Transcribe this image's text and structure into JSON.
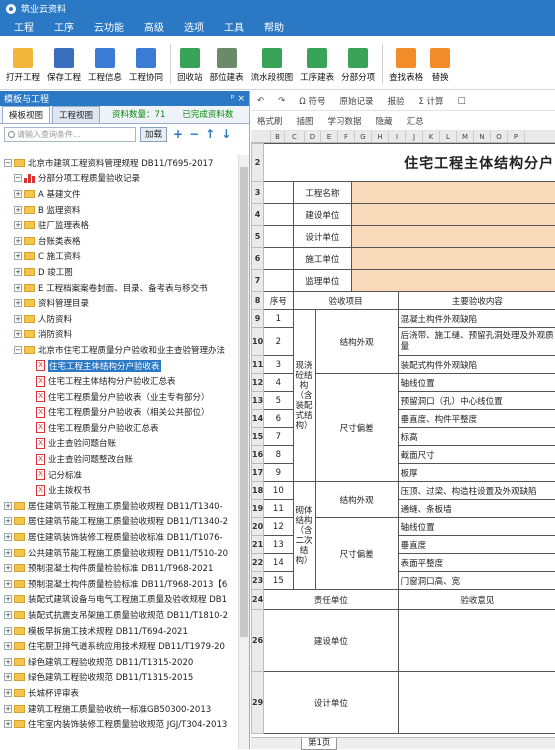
{
  "window": {
    "title": "筑业云资料"
  },
  "menu": [
    "工程",
    "工序",
    "云功能",
    "高级",
    "选项",
    "工具",
    "帮助"
  ],
  "toolbar": [
    {
      "label": "打开工程",
      "icon": "folder-icon",
      "color": "#f2b63b"
    },
    {
      "label": "保存工程",
      "icon": "save-icon",
      "color": "#3a6ebf"
    },
    {
      "label": "工程信息",
      "icon": "building-icon",
      "color": "#3a7bd5"
    },
    {
      "label": "工程协同",
      "icon": "handshake-icon",
      "color": "#3a7bd5"
    },
    {
      "label": "回收站",
      "icon": "recycle-bin-icon",
      "color": "#3aa35a"
    },
    {
      "label": "部位建表",
      "icon": "table-icon",
      "color": "#6a8a6a"
    },
    {
      "label": "流水段视图",
      "icon": "flow-view-icon",
      "color": "#3aa35a"
    },
    {
      "label": "工序建表",
      "icon": "sequence-table-icon",
      "color": "#3aa35a"
    },
    {
      "label": "分部分项",
      "icon": "grid-icon",
      "color": "#3aa35a"
    },
    {
      "label": "查找表格",
      "icon": "find-icon",
      "color": "#f28c28"
    },
    {
      "label": "替换",
      "icon": "replace-icon",
      "color": "#f28c28"
    }
  ],
  "left_panel": {
    "title": "模板与工程",
    "pin": "ᵖ ×",
    "tabs": [
      "模板视图",
      "工程视图"
    ],
    "stats": "资料数量：71　　已完成资料数",
    "search_placeholder": "请输入查询条件...",
    "search_button": "加载",
    "tree": [
      {
        "d": 0,
        "t": "fold",
        "e": "−",
        "text": "北京市建筑工程资料管理规程 DB11/T695-2017"
      },
      {
        "d": 1,
        "t": "bar",
        "e": "−",
        "text": "分部分项工程质量验收记录"
      },
      {
        "d": 1,
        "t": "fold",
        "e": "+",
        "text": "A 基建文件"
      },
      {
        "d": 1,
        "t": "fold",
        "e": "+",
        "text": "B 监理资料"
      },
      {
        "d": 1,
        "t": "fold",
        "e": "+",
        "text": "驻厂监理表格"
      },
      {
        "d": 1,
        "t": "fold",
        "e": "+",
        "text": "台账类表格"
      },
      {
        "d": 1,
        "t": "fold",
        "e": "+",
        "text": "C 施工资料"
      },
      {
        "d": 1,
        "t": "fold",
        "e": "+",
        "text": "D 竣工图"
      },
      {
        "d": 1,
        "t": "fold",
        "e": "+",
        "text": "E 工程档案案卷封面、目录、备考表与移交书"
      },
      {
        "d": 1,
        "t": "fold",
        "e": "+",
        "text": "资料管理目录"
      },
      {
        "d": 1,
        "t": "fold",
        "e": "+",
        "text": "人防资料"
      },
      {
        "d": 1,
        "t": "fold",
        "e": "+",
        "text": "消防资料"
      },
      {
        "d": 1,
        "t": "fold",
        "e": "−",
        "text": "北京市住宅工程质量分户验收和业主查验管理办法"
      },
      {
        "d": 2,
        "t": "doc",
        "e": "",
        "text": "住宅工程主体结构分户验收表",
        "sel": true
      },
      {
        "d": 2,
        "t": "doc",
        "e": "",
        "text": "住宅工程主体结构分户验收汇总表"
      },
      {
        "d": 2,
        "t": "doc",
        "e": "",
        "text": "住宅工程质量分户验收表（业主专有部分）"
      },
      {
        "d": 2,
        "t": "doc",
        "e": "",
        "text": "住宅工程质量分户验收表（相关公共部位）"
      },
      {
        "d": 2,
        "t": "doc",
        "e": "",
        "text": "住宅工程质量分户验收汇总表"
      },
      {
        "d": 2,
        "t": "doc",
        "e": "",
        "text": "业主查验问题台账"
      },
      {
        "d": 2,
        "t": "doc",
        "e": "",
        "text": "业主查验问题整改台账"
      },
      {
        "d": 2,
        "t": "doc",
        "e": "",
        "text": "记分标准"
      },
      {
        "d": 2,
        "t": "doc",
        "e": "",
        "text": "业主拨权书"
      },
      {
        "d": 0,
        "t": "fold",
        "e": "+",
        "text": "居住建筑节能工程施工质量验收规程 DB11/T1340-"
      },
      {
        "d": 0,
        "t": "fold",
        "e": "+",
        "text": "居住建筑节能工程施工质量验收规程 DB11/T1340-2"
      },
      {
        "d": 0,
        "t": "fold",
        "e": "+",
        "text": "居住建筑装饰装修工程质量验收标准 DB11/T1076-"
      },
      {
        "d": 0,
        "t": "fold",
        "e": "+",
        "text": "公共建筑节能工程施工质量验收规程 DB11/T510-20"
      },
      {
        "d": 0,
        "t": "fold",
        "e": "+",
        "text": "预制混凝土构件质量检验标准 DB11/T968-2021"
      },
      {
        "d": 0,
        "t": "fold",
        "e": "+",
        "text": "预制混凝土构件质量检验标准 DB11/T968-2013【6"
      },
      {
        "d": 0,
        "t": "fold",
        "e": "+",
        "text": "装配式建筑设备与电气工程施工质量及验收规程 DB1"
      },
      {
        "d": 0,
        "t": "fold",
        "e": "+",
        "text": "装配式抗震支吊架施工质量验收规范 DB11/T1810-2"
      },
      {
        "d": 0,
        "t": "fold",
        "e": "+",
        "text": "模板早拆施工技术规程 DB11/T694-2021"
      },
      {
        "d": 0,
        "t": "fold",
        "e": "+",
        "text": "住宅厨卫排气道系统应用技术规程 DB11/T1979-20"
      },
      {
        "d": 0,
        "t": "fold",
        "e": "+",
        "text": "绿色建筑工程验收规范 DB11/T1315-2020"
      },
      {
        "d": 0,
        "t": "fold",
        "e": "+",
        "text": "绿色建筑工程验收规范 DB11/T1315-2015"
      },
      {
        "d": 0,
        "t": "fold",
        "e": "+",
        "text": "长城杯评审表"
      },
      {
        "d": 0,
        "t": "fold",
        "e": "+",
        "text": "建筑工程施工质量验收统一标准GB50300-2013"
      },
      {
        "d": 0,
        "t": "fold",
        "e": "+",
        "text": "住宅室内装饰装修工程质量验收规范 JGJ/T304-2013"
      }
    ]
  },
  "format_toolbar": {
    "row1": [
      "↶",
      "↷",
      "Ω 符号",
      "原始记录",
      "报验",
      "Σ 计算",
      "□"
    ],
    "row2": [
      "格式刷",
      "插图",
      "学习数据",
      "隐藏",
      "汇总"
    ]
  },
  "sheet": {
    "col_letters": [
      "B",
      "C",
      "D",
      "E",
      "F",
      "G",
      "H",
      "I",
      "J",
      "K",
      "L",
      "M",
      "N",
      "O",
      "P"
    ],
    "title": "住宅工程主体结构分户",
    "info_labels": [
      "工程名称",
      "建设单位",
      "设计单位",
      "施工单位",
      "监理单位"
    ],
    "header": {
      "no": "序号",
      "item": "验收项目",
      "content": "主要验收内容"
    },
    "group1": "现浇砼结构（含装配式结构）",
    "group2": "砌体结构（含二次结构）",
    "sub_appearance": "结构外观",
    "sub_size": "尺寸偏差",
    "rows": [
      {
        "rn": "9",
        "no": "1",
        "c": "混凝土构件外观缺陷"
      },
      {
        "rn": "10",
        "no": "2",
        "c": "后浇带、施工缝、预留孔洞处理及外观质量"
      },
      {
        "rn": "11",
        "no": "3",
        "c": "装配式构件外观缺陷"
      },
      {
        "rn": "12",
        "no": "4",
        "c": "轴线位置"
      },
      {
        "rn": "13",
        "no": "5",
        "c": "预留洞口（孔）中心线位置"
      },
      {
        "rn": "14",
        "no": "6",
        "c": "垂直度、构件平整度"
      },
      {
        "rn": "15",
        "no": "7",
        "c": "标高"
      },
      {
        "rn": "16",
        "no": "8",
        "c": "截面尺寸"
      },
      {
        "rn": "17",
        "no": "9",
        "c": "板厚"
      },
      {
        "rn": "18",
        "no": "10",
        "c": "压顶、过梁、构造柱设置及外观缺陷"
      },
      {
        "rn": "19",
        "no": "11",
        "c": "通缝、条板墙"
      },
      {
        "rn": "20",
        "no": "12",
        "c": "轴线位置"
      },
      {
        "rn": "21",
        "no": "13",
        "c": "垂直度"
      },
      {
        "rn": "22",
        "no": "14",
        "c": "表面平整度"
      },
      {
        "rn": "23",
        "no": "15",
        "c": "门窗洞口高、宽"
      }
    ],
    "footer": {
      "resp": "责任单位",
      "opinion": "验收意见",
      "build": "建设单位",
      "design": "设计单位"
    },
    "row_nums": {
      "title": "2",
      "info": [
        "3",
        "4",
        "5",
        "6",
        "7"
      ],
      "hdr": "8",
      "r24": "24",
      "r26": "26",
      "r29": "29"
    },
    "tab": "第1页"
  }
}
